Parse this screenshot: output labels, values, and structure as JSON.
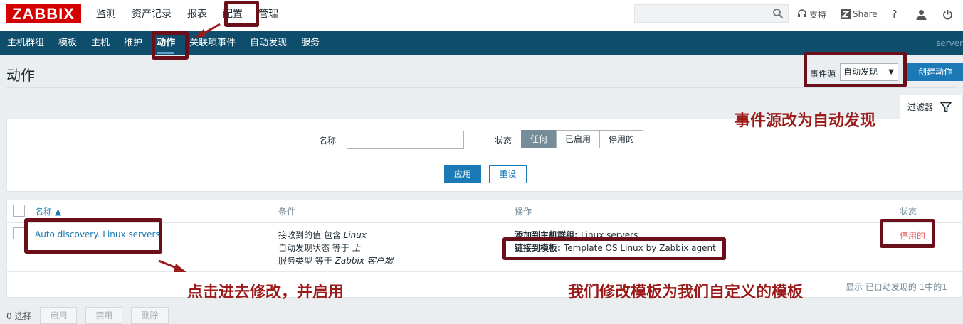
{
  "brand": "ZABBIX",
  "main_menu": [
    "监测",
    "资产记录",
    "报表",
    "配置",
    "管理"
  ],
  "main_menu_active": "配置",
  "top_icons": [
    {
      "icon": "headset-icon",
      "label": "支持"
    },
    {
      "icon": "share-z-icon",
      "label": "Share"
    },
    {
      "icon": "help-icon",
      "label": "?"
    },
    {
      "icon": "user-icon",
      "label": ""
    },
    {
      "icon": "power-icon",
      "label": ""
    }
  ],
  "sub_menu": [
    "主机群组",
    "模板",
    "主机",
    "维护",
    "动作",
    "关联项事件",
    "自动发现",
    "服务"
  ],
  "sub_menu_active": "动作",
  "server_label": "server",
  "page_title": "动作",
  "event_source": {
    "label": "事件源",
    "value": "自动发现"
  },
  "create_button": "创建动作",
  "filter": {
    "tab_label": "过滤器",
    "name_label": "名称",
    "name_value": "",
    "status_label": "状态",
    "status_options": [
      "任何",
      "已启用",
      "停用的"
    ],
    "status_selected": "任何",
    "apply": "应用",
    "reset": "重设"
  },
  "table": {
    "columns": [
      "名称 ▲",
      "条件",
      "操作",
      "状态"
    ],
    "rows": [
      {
        "name": "Auto discovery. Linux servers.",
        "conditions": [
          {
            "text": "接收到的值 包含 ",
            "em": "Linux"
          },
          {
            "text": "自动发现状态 等于 ",
            "em": "上"
          },
          {
            "text": "服务类型 等于 ",
            "em": "Zabbix 客户端"
          }
        ],
        "operations": [
          {
            "label": "添加到主机群组: ",
            "value": "Linux servers"
          },
          {
            "label": "链接到模板: ",
            "value": "Template OS Linux by Zabbix agent"
          }
        ],
        "status": "停用的"
      }
    ],
    "footer": "显示 已自动发现的 1中的1"
  },
  "mass_actions": {
    "selected": "0 选择",
    "buttons": [
      "启用",
      "禁用",
      "删除"
    ]
  },
  "annotations": {
    "event_source_note": "事件源改为自动发现",
    "click_note": "点击进去修改，并启用",
    "template_note": "我们修改模板为我们自定义的模板"
  },
  "colors": {
    "brand_red": "#d40000",
    "nav_blue": "#0e4d6b",
    "link_blue": "#1b7ab6",
    "disabled_red": "#e45959",
    "annotation_red": "#9b1a1a",
    "annotation_box": "#6b0f1a"
  }
}
